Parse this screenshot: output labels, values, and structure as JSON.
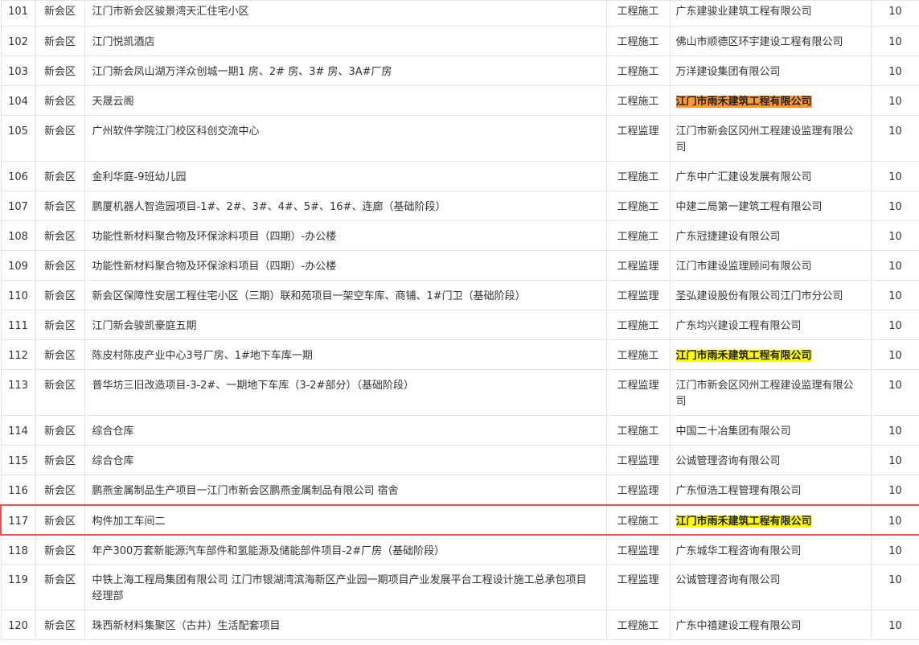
{
  "rows": [
    {
      "no": "101",
      "district": "新会区",
      "project": "江门市新会区骏景湾天汇住宅小区",
      "type": "工程施工",
      "company": "广东建骏业建筑工程有限公司",
      "score": "10",
      "highlight": ""
    },
    {
      "no": "102",
      "district": "新会区",
      "project": "江门悦凯酒店",
      "type": "工程施工",
      "company": "佛山市顺德区环宇建设工程有限公司",
      "score": "10",
      "highlight": ""
    },
    {
      "no": "103",
      "district": "新会区",
      "project": "江门新会凤山湖万洋众创城一期1 房、2# 房、3# 房、3A#厂房",
      "type": "工程施工",
      "company": "万洋建设集团有限公司",
      "score": "10",
      "highlight": ""
    },
    {
      "no": "104",
      "district": "新会区",
      "project": "天晟云阁",
      "type": "工程施工",
      "company": "江门市雨禾建筑工程有限公司",
      "score": "10",
      "highlight": "orange"
    },
    {
      "no": "105",
      "district": "新会区",
      "project": "广州软件学院江门校区科创交流中心",
      "type": "工程监理",
      "company": "江门市新会区冈州工程建设监理有限公司",
      "score": "10",
      "highlight": "",
      "tall": true
    },
    {
      "no": "106",
      "district": "新会区",
      "project": "金利华庭-9班幼儿园",
      "type": "工程施工",
      "company": "广东中广汇建设发展有限公司",
      "score": "10",
      "highlight": ""
    },
    {
      "no": "107",
      "district": "新会区",
      "project": "鹏厦机器人智造园项目-1#、2#、3#、4#、5#、16#、连廊（基础阶段）",
      "type": "工程施工",
      "company": "中建二局第一建筑工程有限公司",
      "score": "10",
      "highlight": ""
    },
    {
      "no": "108",
      "district": "新会区",
      "project": "功能性新材料聚合物及环保涂料项目（四期）-办公楼",
      "type": "工程施工",
      "company": "广东冠捷建设有限公司",
      "score": "10",
      "highlight": ""
    },
    {
      "no": "109",
      "district": "新会区",
      "project": "功能性新材料聚合物及环保涂料项目（四期）-办公楼",
      "type": "工程监理",
      "company": "江门市建设监理顾问有限公司",
      "score": "10",
      "highlight": ""
    },
    {
      "no": "110",
      "district": "新会区",
      "project": "新会区保障性安居工程住宅小区（三期）联和苑项目一架空车库、商铺、1#门卫（基础阶段）",
      "type": "工程监理",
      "company": "圣弘建设股份有限公司江门市分公司",
      "score": "10",
      "highlight": ""
    },
    {
      "no": "111",
      "district": "新会区",
      "project": "江门新会骏凯豪庭五期",
      "type": "工程施工",
      "company": "广东均兴建设工程有限公司",
      "score": "10",
      "highlight": ""
    },
    {
      "no": "112",
      "district": "新会区",
      "project": "陈皮村陈皮产业中心3号厂房、1#地下车库一期",
      "type": "工程施工",
      "company": "江门市雨禾建筑工程有限公司",
      "score": "10",
      "highlight": "yellow"
    },
    {
      "no": "113",
      "district": "新会区",
      "project": "普华坊三旧改造项目-3-2#、一期地下车库（3-2#部分）（基础阶段）",
      "type": "工程监理",
      "company": "江门市新会区冈州工程建设监理有限公司",
      "score": "10",
      "highlight": "",
      "tall": true
    },
    {
      "no": "114",
      "district": "新会区",
      "project": "综合仓库",
      "type": "工程施工",
      "company": "中国二十冶集团有限公司",
      "score": "10",
      "highlight": ""
    },
    {
      "no": "115",
      "district": "新会区",
      "project": "综合仓库",
      "type": "工程监理",
      "company": "公诚管理咨询有限公司",
      "score": "10",
      "highlight": ""
    },
    {
      "no": "116",
      "district": "新会区",
      "project": "鹏燕金属制品生产项目一江门市新会区鹏燕金属制品有限公司 宿舍",
      "type": "工程监理",
      "company": "广东恒浩工程管理有限公司",
      "score": "10",
      "highlight": ""
    },
    {
      "no": "117",
      "district": "新会区",
      "project": "构件加工车间二",
      "type": "工程施工",
      "company": "江门市雨禾建筑工程有限公司",
      "score": "10",
      "highlight": "yellow",
      "selected": true
    },
    {
      "no": "118",
      "district": "新会区",
      "project": "年产300万套新能源汽车部件和氢能源及储能部件项目-2#厂房（基础阶段）",
      "type": "工程监理",
      "company": "广东城华工程咨询有限公司",
      "score": "10",
      "highlight": ""
    },
    {
      "no": "119",
      "district": "新会区",
      "project": "中铁上海工程局集团有限公司 江门市银湖湾滨海新区产业园一期项目产业发展平台工程设计施工总承包项目经理部",
      "type": "工程监理",
      "company": "公诚管理咨询有限公司",
      "score": "10",
      "highlight": "",
      "tall": true
    },
    {
      "no": "120",
      "district": "新会区",
      "project": "珠西新材料集聚区（古井）生活配套项目",
      "type": "工程施工",
      "company": "广东中禧建设工程有限公司",
      "score": "10",
      "highlight": ""
    }
  ]
}
